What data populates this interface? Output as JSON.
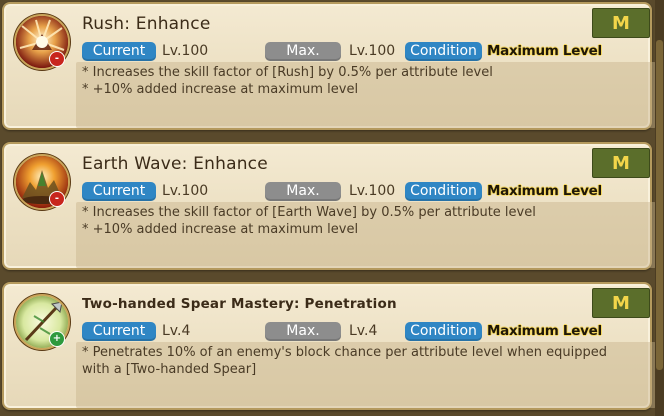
{
  "skills": [
    {
      "name": "Rush: Enhance",
      "icon": "rush-skill-icon",
      "badge": "-",
      "grade": "M",
      "current_label": "Current",
      "current_level": "Lv.100",
      "max_label": "Max.",
      "max_level": "Lv.100",
      "condition_label": "Condition",
      "condition_value": "Maximum Level",
      "desc_line1": "* Increases the skill factor of [Rush] by 0.5% per attribute level",
      "desc_line2": "* +10% added increase at maximum level"
    },
    {
      "name": "Earth Wave: Enhance",
      "icon": "earth-wave-skill-icon",
      "badge": "-",
      "grade": "M",
      "current_label": "Current",
      "current_level": "Lv.100",
      "max_label": "Max.",
      "max_level": "Lv.100",
      "condition_label": "Condition",
      "condition_value": "Maximum Level",
      "desc_line1": "* Increases the skill factor of [Earth Wave] by 0.5% per attribute level",
      "desc_line2": "* +10% added increase at maximum level"
    },
    {
      "name": "Two-handed Spear Mastery: Penetration",
      "icon": "spear-mastery-icon",
      "badge": "+",
      "grade": "M",
      "current_label": "Current",
      "current_level": "Lv.4",
      "max_label": "Max.",
      "max_level": "Lv.4",
      "condition_label": "Condition",
      "condition_value": "Maximum Level",
      "desc_line1": "* Penetrates 10% of an enemy's block chance per attribute level when equipped",
      "desc_line2": "with a [Two-handed Spear]"
    }
  ],
  "colors": {
    "pill_blue": "#2f86c4",
    "pill_gray": "#8d8d8d",
    "grade_bg": "#5b6e2b",
    "grade_text": "#f3d54a",
    "badge_red": "#c8251d",
    "badge_green": "#2e9a3e"
  }
}
